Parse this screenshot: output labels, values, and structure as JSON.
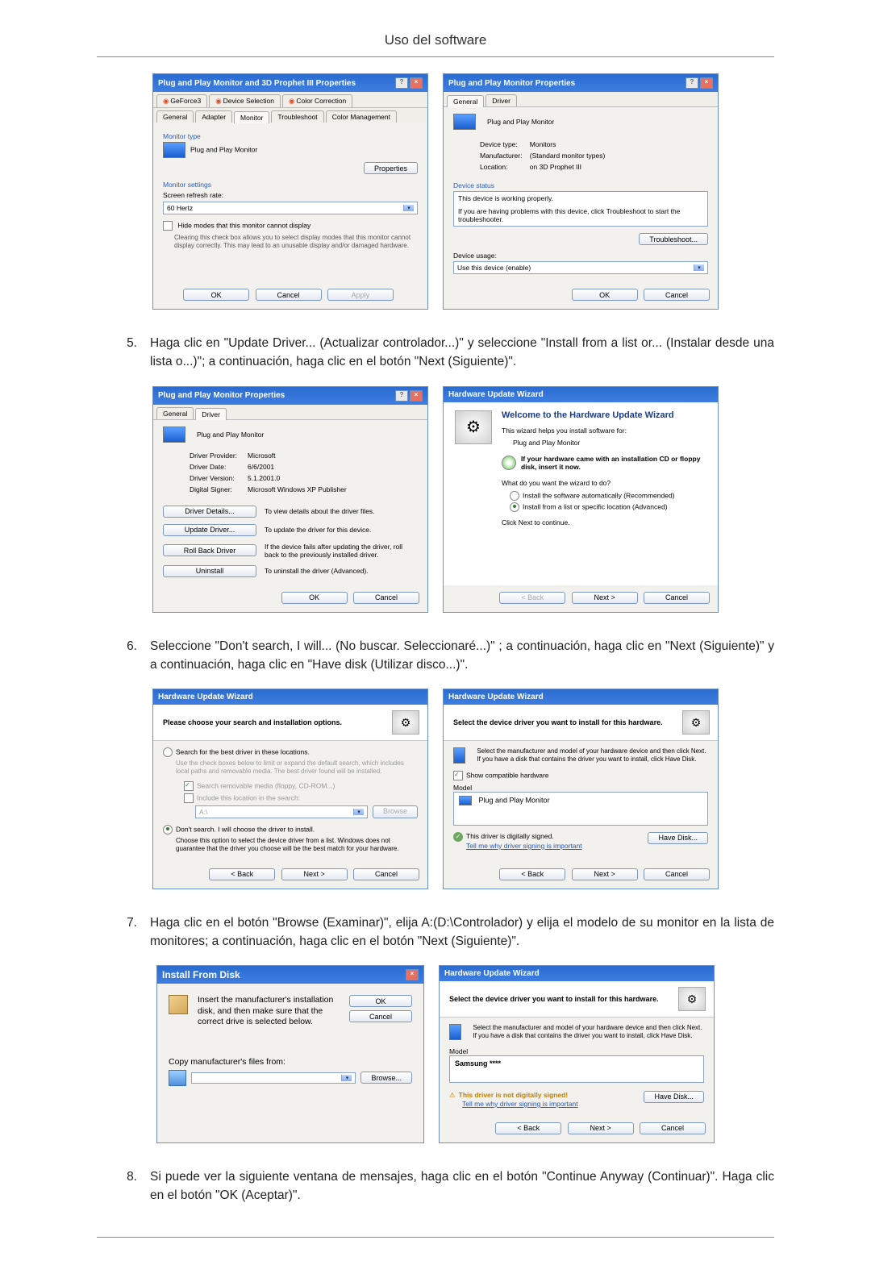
{
  "page_title": "Uso del software",
  "step5": {
    "num": "5.",
    "text": "Haga clic en \"Update Driver... (Actualizar controlador...)\" y seleccione \"Install from a list or... (Instalar desde una lista o...)\"; a continuación, haga clic en el botón \"Next (Siguiente)\"."
  },
  "step6": {
    "num": "6.",
    "text": "Seleccione \"Don't search, I will... (No buscar. Seleccionaré...)\" ; a continuación, haga clic en \"Next (Siguiente)\" y a continuación, haga clic en \"Have disk (Utilizar disco...)\"."
  },
  "step7": {
    "num": "7.",
    "text": "Haga clic en el botón \"Browse (Examinar)\", elija A:(D:\\Controlador) y elija el modelo de su monitor en la lista de monitores; a continuación, haga clic en el botón \"Next (Siguiente)\"."
  },
  "step8": {
    "num": "8.",
    "text": "Si puede ver la siguiente ventana de mensajes, haga clic en el botón \"Continue Anyway (Continuar)\". Haga clic en el botón \"OK (Aceptar)\"."
  },
  "dlg_props3d": {
    "title": "Plug and Play Monitor and 3D Prophet III Properties",
    "tabs_row1": {
      "geforce": "GeForce3",
      "devsel": "Device Selection",
      "colorcorr": "Color Correction"
    },
    "tabs_row2": {
      "general": "General",
      "adapter": "Adapter",
      "monitor": "Monitor",
      "trouble": "Troubleshoot",
      "colormgmt": "Color Management"
    },
    "monitor_type": "Monitor type",
    "monitor_name": "Plug and Play Monitor",
    "properties_btn": "Properties",
    "monitor_settings": "Monitor settings",
    "refresh_label": "Screen refresh rate:",
    "refresh_val": "60 Hertz",
    "hide_modes": "Hide modes that this monitor cannot display",
    "hide_desc": "Clearing this check box allows you to select display modes that this monitor cannot display correctly. This may lead to an unusable display and/or damaged hardware.",
    "ok": "OK",
    "cancel": "Cancel",
    "apply": "Apply"
  },
  "dlg_props": {
    "title": "Plug and Play Monitor Properties",
    "tab_general": "General",
    "tab_driver": "Driver",
    "name": "Plug and Play Monitor",
    "dev_type_l": "Device type:",
    "dev_type_v": "Monitors",
    "manu_l": "Manufacturer:",
    "manu_v": "(Standard monitor types)",
    "loc_l": "Location:",
    "loc_v": "on 3D Prophet III",
    "status": "Device status",
    "status_txt": "This device is working properly.",
    "status_txt2": "If you are having problems with this device, click Troubleshoot to start the troubleshooter.",
    "trouble_btn": "Troubleshoot...",
    "usage": "Device usage:",
    "usage_val": "Use this device (enable)",
    "ok": "OK",
    "cancel": "Cancel"
  },
  "dlg_driver": {
    "title": "Plug and Play Monitor Properties",
    "tab_general": "General",
    "tab_driver": "Driver",
    "name": "Plug and Play Monitor",
    "provider_l": "Driver Provider:",
    "provider_v": "Microsoft",
    "date_l": "Driver Date:",
    "date_v": "6/6/2001",
    "ver_l": "Driver Version:",
    "ver_v": "5.1.2001.0",
    "signer_l": "Digital Signer:",
    "signer_v": "Microsoft Windows XP Publisher",
    "details_btn": "Driver Details...",
    "details_txt": "To view details about the driver files.",
    "update_btn": "Update Driver...",
    "update_txt": "To update the driver for this device.",
    "rollback_btn": "Roll Back Driver",
    "rollback_txt": "If the device fails after updating the driver, roll back to the previously installed driver.",
    "uninstall_btn": "Uninstall",
    "uninstall_txt": "To uninstall the driver (Advanced).",
    "ok": "OK",
    "cancel": "Cancel"
  },
  "wiz_welcome": {
    "title": "Hardware Update Wizard",
    "heading": "Welcome to the Hardware Update Wizard",
    "intro": "This wizard helps you install software for:",
    "device": "Plug and Play Monitor",
    "cd_hint": "If your hardware came with an installation CD or floppy disk, insert it now.",
    "q": "What do you want the wizard to do?",
    "opt1": "Install the software automatically (Recommended)",
    "opt2": "Install from a list or specific location (Advanced)",
    "cont": "Click Next to continue.",
    "back": "< Back",
    "next": "Next >",
    "cancel": "Cancel"
  },
  "wiz_search": {
    "title": "Hardware Update Wizard",
    "heading": "Please choose your search and installation options.",
    "opt1": "Search for the best driver in these locations.",
    "opt1_desc": "Use the check boxes below to limit or expand the default search, which includes local paths and removable media. The best driver found will be installed.",
    "chk1": "Search removable media (floppy, CD-ROM...)",
    "chk2": "Include this location in the search:",
    "path": "A:\\",
    "browse": "Browse",
    "opt2": "Don't search. I will choose the driver to install.",
    "opt2_desc": "Choose this option to select the device driver from a list. Windows does not guarantee that the driver you choose will be the best match for your hardware.",
    "back": "< Back",
    "next": "Next >",
    "cancel": "Cancel"
  },
  "wiz_select": {
    "title": "Hardware Update Wizard",
    "heading": "Select the device driver you want to install for this hardware.",
    "desc": "Select the manufacturer and model of your hardware device and then click Next. If you have a disk that contains the driver you want to install, click Have Disk.",
    "show_compat": "Show compatible hardware",
    "model": "Model",
    "item": "Plug and Play Monitor",
    "signed": "This driver is digitally signed.",
    "tellme": "Tell me why driver signing is important",
    "have_disk": "Have Disk...",
    "back": "< Back",
    "next": "Next >",
    "cancel": "Cancel"
  },
  "dlg_install": {
    "title": "Install From Disk",
    "desc": "Insert the manufacturer's installation disk, and then make sure that the correct drive is selected below.",
    "ok": "OK",
    "cancel": "Cancel",
    "copy": "Copy manufacturer's files from:",
    "browse": "Browse..."
  },
  "wiz_samsung": {
    "title": "Hardware Update Wizard",
    "heading": "Select the device driver you want to install for this hardware.",
    "desc": "Select the manufacturer and model of your hardware device and then click Next. If you have a disk that contains the driver you want to install, click Have Disk.",
    "model": "Model",
    "item": "Samsung ****",
    "warn": "This driver is not digitally signed!",
    "tellme": "Tell me why driver signing is important",
    "have_disk": "Have Disk...",
    "back": "< Back",
    "next": "Next >",
    "cancel": "Cancel"
  }
}
